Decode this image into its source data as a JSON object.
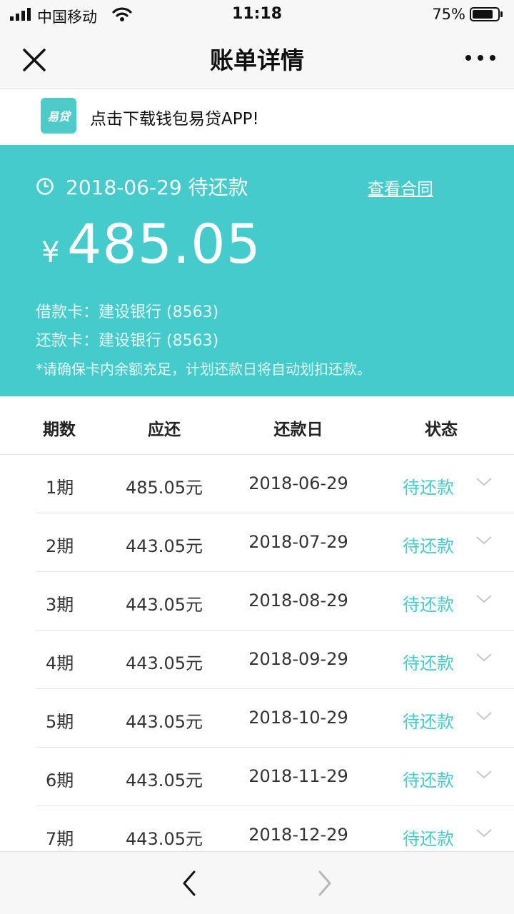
{
  "status_bar": {
    "carrier": "中国移动",
    "time": "11:18",
    "battery": "75%"
  },
  "header": {
    "title": "账单详情",
    "close_icon": "close-icon",
    "more_icon": "more-icon"
  },
  "banner": {
    "logo_text": "易贷",
    "text": "点击下载钱包易贷APP!"
  },
  "summary": {
    "due_text": "2018-06-29 待还款",
    "contract_link": "查看合同",
    "currency": "¥",
    "amount": "485.05",
    "loan_card": "借款卡：建设银行 (8563)",
    "repay_card": "还款卡：建设银行 (8563)",
    "note": "*请确保卡内余额充足，计划还款日将自动划扣还款。"
  },
  "table": {
    "headers": [
      "期数",
      "应还",
      "还款日",
      "状态"
    ],
    "rows": [
      {
        "period": "1期",
        "amount": "485.05元",
        "date": "2018-06-29",
        "status": "待还款"
      },
      {
        "period": "2期",
        "amount": "443.05元",
        "date": "2018-07-29",
        "status": "待还款"
      },
      {
        "period": "3期",
        "amount": "443.05元",
        "date": "2018-08-29",
        "status": "待还款"
      },
      {
        "period": "4期",
        "amount": "443.05元",
        "date": "2018-09-29",
        "status": "待还款"
      },
      {
        "period": "5期",
        "amount": "443.05元",
        "date": "2018-10-29",
        "status": "待还款"
      },
      {
        "period": "6期",
        "amount": "443.05元",
        "date": "2018-11-29",
        "status": "待还款"
      },
      {
        "period": "7期",
        "amount": "443.05元",
        "date": "2018-12-29",
        "status": "待还款"
      }
    ]
  },
  "colors": {
    "accent": "#45cbcb",
    "text": "#333333"
  }
}
